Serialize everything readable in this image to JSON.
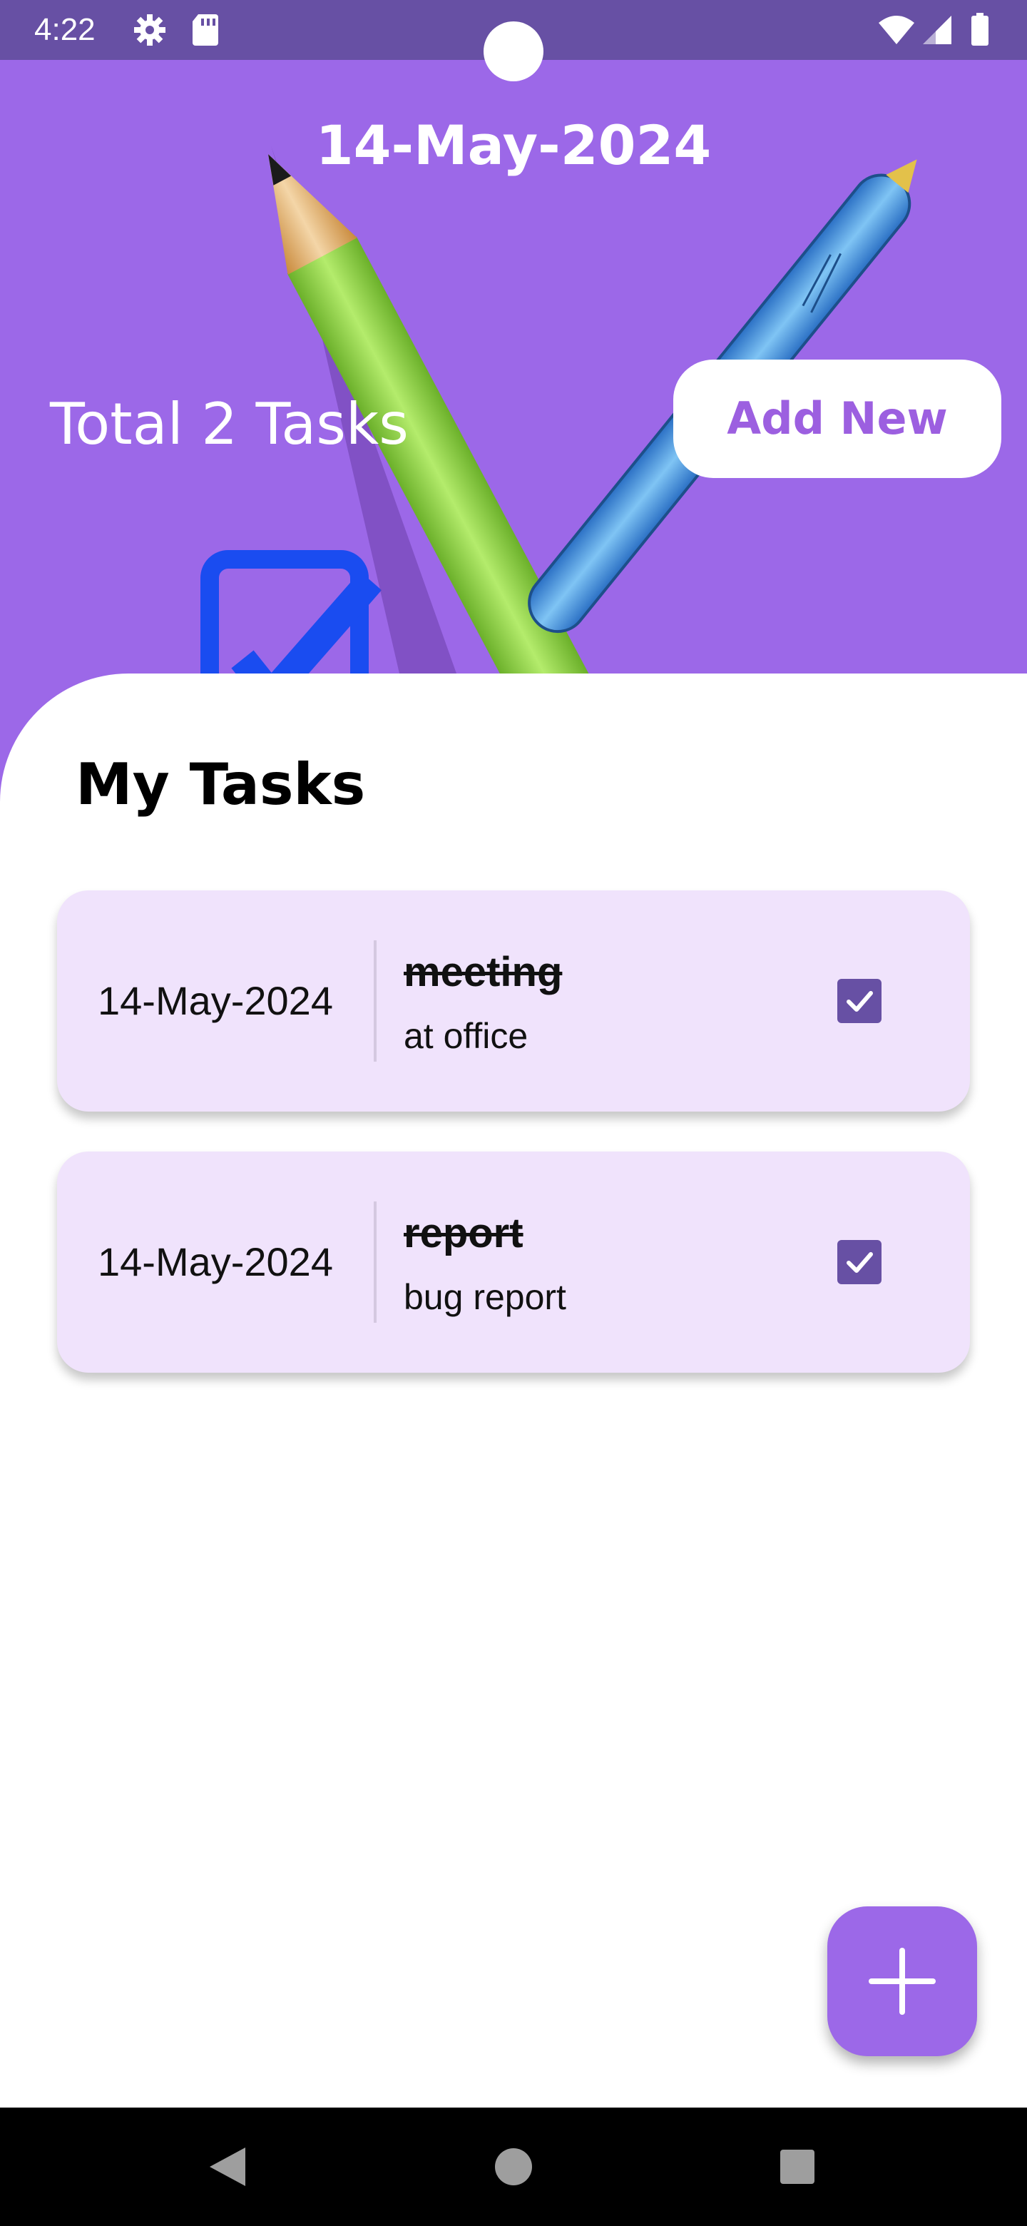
{
  "status_bar": {
    "time": "4:22",
    "icons": [
      "gear-icon",
      "sd-card-icon",
      "wifi-icon",
      "signal-icon",
      "battery-icon"
    ]
  },
  "header": {
    "date": "14-May-2024",
    "total_tasks": "Total 2 Tasks",
    "add_new_label": "Add New",
    "art": [
      "pencil-illustration",
      "pen-illustration",
      "checkbox-illustration"
    ]
  },
  "main": {
    "section_title": "My Tasks",
    "tasks": [
      {
        "date": "14-May-2024",
        "title": "meeting",
        "description": "at office",
        "completed": true
      },
      {
        "date": "14-May-2024",
        "title": "report",
        "description": "bug report",
        "completed": true
      }
    ]
  },
  "fab": {
    "icon": "plus-icon"
  },
  "nav_bar": {
    "icons": [
      "back-icon",
      "home-icon",
      "recents-icon"
    ]
  },
  "colors": {
    "status_bar": "#6750a4",
    "header_purple": "#9c68e8",
    "card_background": "#f0e3fc",
    "checkbox": "#6750a4",
    "accent_text": "#9c5fe0"
  }
}
